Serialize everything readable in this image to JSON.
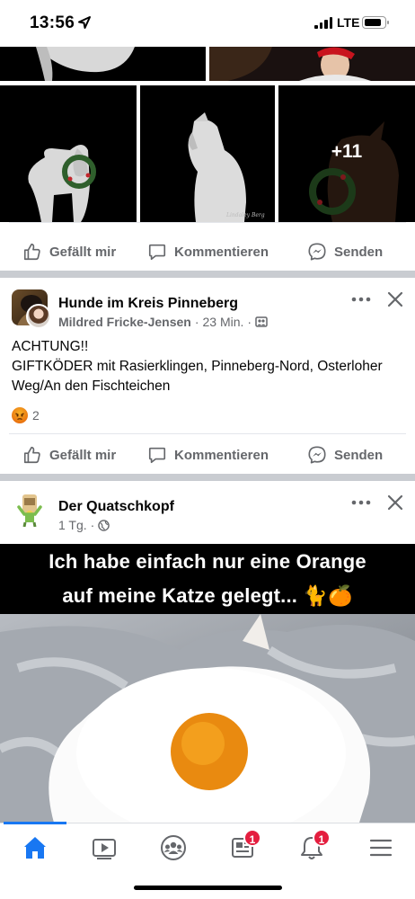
{
  "statusbar": {
    "time": "13:56",
    "network": "LTE"
  },
  "post1": {
    "photos": {
      "more_count": "+11",
      "watermark": "Lindaley Berg Photography"
    },
    "actions": {
      "like": "Gefällt mir",
      "comment": "Kommentieren",
      "send": "Senden"
    }
  },
  "post2": {
    "group": "Hunde im Kreis Pinneberg",
    "author": "Mildred Fricke-Jensen",
    "time": "23 Min.",
    "text_line1": "ACHTUNG!!",
    "text_line2": "GIFTKÖDER mit Rasierklingen, Pinneberg-Nord, Osterloher Weg/An den Fischteichen",
    "reaction_count": "2",
    "actions": {
      "like": "Gefällt mir",
      "comment": "Kommentieren",
      "send": "Senden"
    }
  },
  "post3": {
    "page": "Der Quatschkopf",
    "time": "1 Tg.",
    "meme_line1": "Ich habe einfach nur eine Orange",
    "meme_line2": "auf meine Katze gelegt... 🐈🍊"
  },
  "bottomnav": {
    "tabs": [
      "home-icon",
      "video-icon",
      "groups-icon",
      "news-icon",
      "bell-icon",
      "menu-icon"
    ],
    "news_badge": "1",
    "notifications_badge": "1",
    "accent": "#1877f2"
  }
}
